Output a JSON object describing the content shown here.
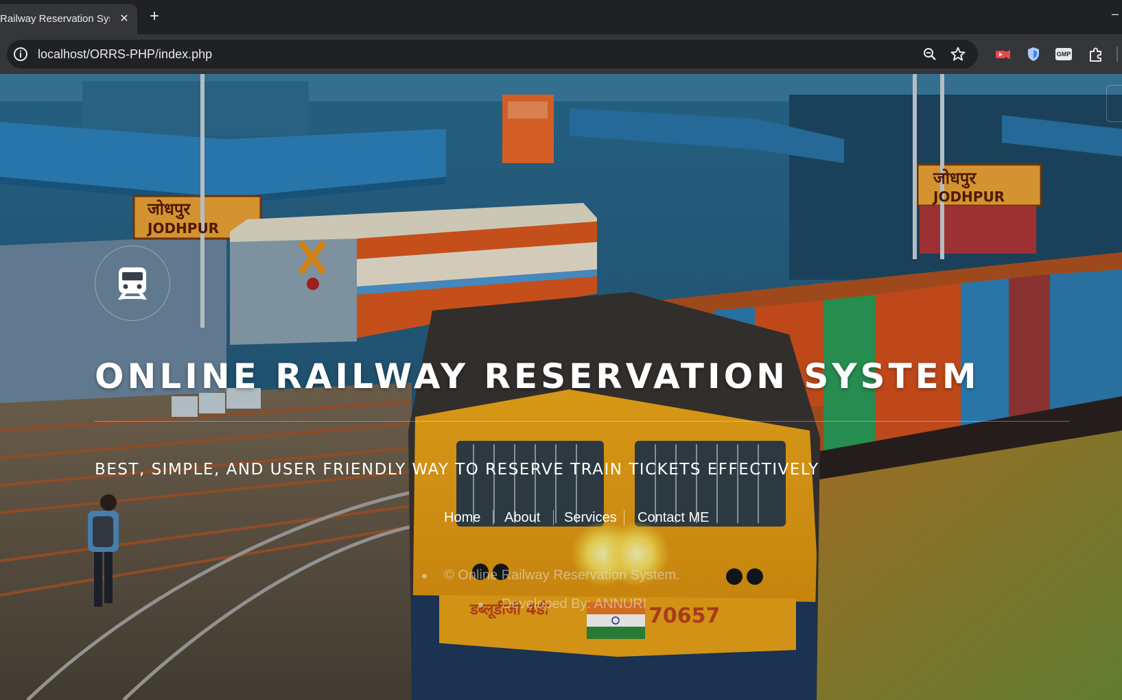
{
  "browser": {
    "tab_title": "Railway Reservation System",
    "tab_close": "✕",
    "new_tab": "+",
    "minimize": "–",
    "url": "localhost/ORRS-PHP/index.php",
    "extension_gmp": "GMP",
    "icons": [
      "site-info-icon",
      "zoom-icon",
      "star-icon",
      "video-extension-icon",
      "shield-extension-icon",
      "gmp-extension-icon",
      "puzzle-extension-icon"
    ]
  },
  "hero": {
    "title": "ONLINE RAILWAY RESERVATION SYSTEM",
    "subtitle": "BEST, SIMPLE, AND USER FRIENDLY WAY TO RESERVE TRAIN TICKETS EFFECTIVELY",
    "logo_icon": "train-icon",
    "scene_signs": [
      "जोधपुर",
      "JODHPUR"
    ],
    "locomotive_number": "70657",
    "locomotive_lettering": "डब्लूडीजी 4डी"
  },
  "nav": {
    "items": [
      "Home",
      "About",
      "Services",
      "Contact ME"
    ]
  },
  "footer": {
    "copyright": "© Online Railway Reservation System.",
    "developer": "Developed By: ANNURI"
  },
  "colors": {
    "chrome_dark": "#202124",
    "chrome_toolbar": "#35363a",
    "chrome_text": "#e8eaed",
    "hero_text": "#ffffff",
    "locomotive_yellow": "#f2a516",
    "container_orange": "#d9531e",
    "container_blue": "#2f7fb6"
  }
}
